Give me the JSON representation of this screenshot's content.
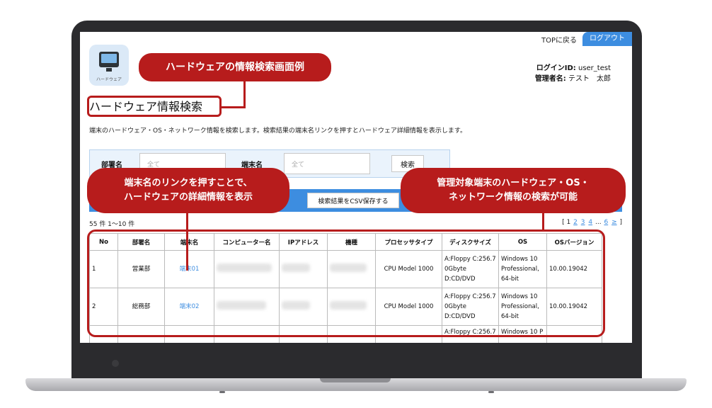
{
  "nav": {
    "top_link": "TOPに戻る",
    "logout": "ログアウト"
  },
  "app_icon": {
    "caption": "ハードウェア"
  },
  "login": {
    "id_label": "ログインID:",
    "id_value": "user_test",
    "admin_label": "管理者名:",
    "admin_value": "テスト　太郎"
  },
  "page_title": "ハードウェア情報検索",
  "description": "端末のハードウェア・OS・ネットワーク情報を検索します。検索結果の端末名リンクを押すとハードウェア詳細情報を表示します。",
  "search": {
    "dept_label": "部署名",
    "dept_placeholder": "全て",
    "terminal_label": "端末名",
    "terminal_placeholder": "全て",
    "search_button": "検索"
  },
  "csv_button": "検索結果をCSV保存する",
  "result_count": "55 件 1〜10 件",
  "pager": {
    "open": "[",
    "pages": [
      "1",
      "2",
      "3",
      "4"
    ],
    "ellipsis": "...",
    "last": "6",
    "next": "≥",
    "close": "]"
  },
  "table": {
    "headers": [
      "No",
      "部署名",
      "端末名",
      "コンピューター名",
      "IPアドレス",
      "機種",
      "プロセッサタイプ",
      "ディスクサイズ",
      "OS",
      "OSバージョン"
    ],
    "rows": [
      {
        "no": "1",
        "dept": "営業部",
        "terminal": "端末01",
        "cpu": "CPU Model 1000",
        "disk": "A:Floppy C:256.7 0Gbyte D:CD/DVD",
        "os": "Windows 10 Professional, 64-bit",
        "osver": "10.00.19042"
      },
      {
        "no": "2",
        "dept": "総務部",
        "terminal": "端末02",
        "cpu": "CPU Model 1000",
        "disk": "A:Floppy C:256.7 0Gbyte D:CD/DVD",
        "os": "Windows 10 Professional, 64-bit",
        "osver": "10.00.19042"
      },
      {
        "no": "",
        "dept": "",
        "terminal": "",
        "cpu": "",
        "disk": "A:Floppy C:256.7",
        "os": "Windows 10 P",
        "osver": ""
      }
    ]
  },
  "callouts": {
    "example": "ハードウェアの情報検索画面例",
    "link_l1": "端末名のリンクを押すことで、",
    "link_l2": "ハードウェアの詳細情報を表示",
    "manage_l1": "管理対象端末のハードウェア・OS・",
    "manage_l2": "ネットワーク情報の検索が可能"
  },
  "colors": {
    "accent": "#3d8de0",
    "callout": "#b71c1c"
  }
}
